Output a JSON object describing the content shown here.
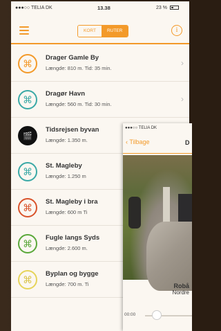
{
  "statusbar": {
    "carrier": "●●●○○ TELIA DK",
    "time": "13.38",
    "battery": "23 %"
  },
  "navbar": {
    "seg_left": "KORT",
    "seg_right": "RUTER",
    "info": "i"
  },
  "routes": [
    {
      "title": "Drager Gamle By",
      "sub": "Længde: 810 m. Tid: 35 min.",
      "color": "#f39a2a",
      "icon": "drone-icon"
    },
    {
      "title": "Dragør Havn",
      "sub": "Længde: 560 m. Tid: 30 min.",
      "color": "#3aa9a6",
      "icon": "drone-icon"
    },
    {
      "title": "Tidsrejsen byvan",
      "sub": "Længde: 1.350 m.",
      "color": "#111111",
      "icon": "film-icon"
    },
    {
      "title": "St. Magleby",
      "sub": "Længde: 1.250 m",
      "color": "#3aa9a6",
      "icon": "drone-icon"
    },
    {
      "title": "St. Magleby i bra",
      "sub": "Længde: 600 m Ti",
      "color": "#d9532b",
      "icon": "drone-icon"
    },
    {
      "title": "Fugle langs Syds",
      "sub": "Længde: 2.600 m.",
      "color": "#5aa83a",
      "icon": "drone-icon"
    },
    {
      "title": "Byplan og bygge",
      "sub": "Længde: 700 m. Ti",
      "color": "#e6d45a",
      "icon": "drone-icon"
    }
  ],
  "detail": {
    "status": "●●●○○ TELIA DK",
    "back": "Tilbage",
    "nav_letter": "D",
    "title": "Robå",
    "subtitle": "Nordre",
    "time": "00:00"
  },
  "colors": {
    "accent": "#f39a2a"
  }
}
